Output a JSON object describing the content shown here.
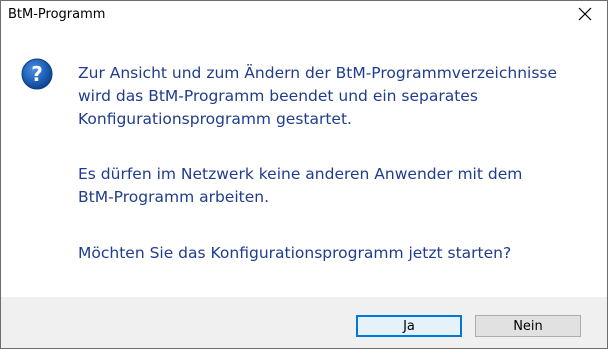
{
  "window": {
    "title": "BtM-Programm",
    "close_icon": "close-icon"
  },
  "message": {
    "icon": "question-icon",
    "paragraph1": [
      "Zur Ansicht und zum Ändern der BtM-Programmverzeichnisse",
      "wird das BtM-Programm beendet und ein separates",
      "Konfigurationsprogramm gestartet."
    ],
    "paragraph2": [
      "Es dürfen im Netzwerk keine anderen Anwender mit dem",
      "BtM-Programm arbeiten."
    ],
    "paragraph3": [
      "Möchten Sie das Konfigurationsprogramm jetzt starten?"
    ]
  },
  "buttons": {
    "yes_label": "Ja",
    "no_label": "Nein"
  },
  "colors": {
    "message_text": "#1f3d8f",
    "icon_blue": "#1c5fb5",
    "footer_bg": "#f0f0f0",
    "default_button_border": "#0078d7"
  }
}
